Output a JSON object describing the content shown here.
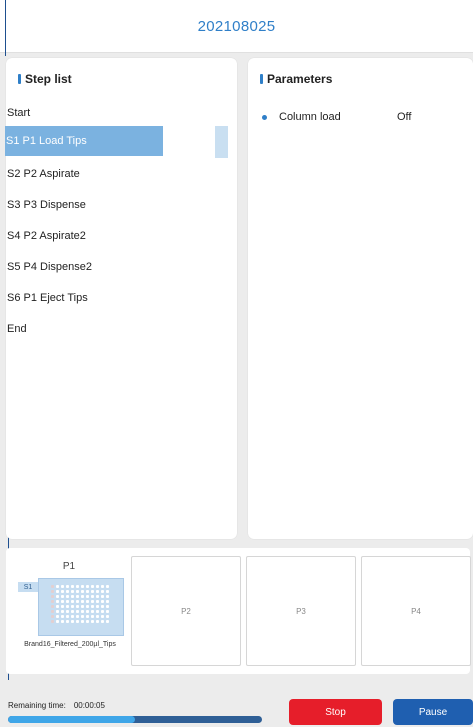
{
  "window": {
    "title": "202108025"
  },
  "step_list": {
    "header": "Step list",
    "items": [
      {
        "label": "Start",
        "selected": false
      },
      {
        "label": "S1 P1 Load Tips",
        "selected": true
      },
      {
        "label": "S2 P2 Aspirate",
        "selected": false
      },
      {
        "label": "S3 P3 Dispense",
        "selected": false
      },
      {
        "label": "S4 P2 Aspirate2",
        "selected": false
      },
      {
        "label": "S5 P4 Dispense2",
        "selected": false
      },
      {
        "label": "S6 P1 Eject Tips",
        "selected": false
      },
      {
        "label": "End",
        "selected": false
      }
    ]
  },
  "parameters": {
    "header": "Parameters",
    "rows": [
      {
        "name": "Column load",
        "value": "Off"
      }
    ]
  },
  "deck": {
    "slots": [
      {
        "label": "P1",
        "plate_tag": "S1",
        "plate_name": "Brand16_Filtered_200µl_Tips"
      },
      {
        "label": "P2"
      },
      {
        "label": "P3"
      },
      {
        "label": "P4"
      }
    ]
  },
  "footer": {
    "remaining_label": "Remaining time:",
    "remaining_value": "00:00:05",
    "progress": 0.5,
    "stop_label": "Stop",
    "pause_label": "Pause"
  },
  "colors": {
    "accent": "#2f7fc8",
    "selected_step": "#7bb2e0",
    "stop": "#e61e2a",
    "pause": "#1f5fb0"
  }
}
